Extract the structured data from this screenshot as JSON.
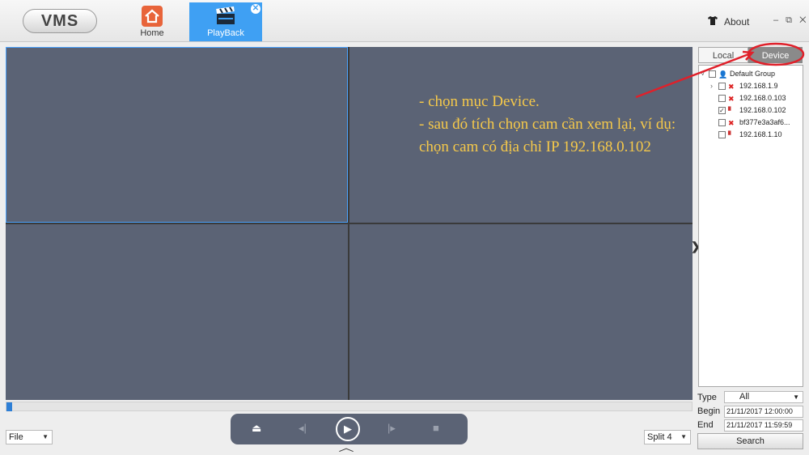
{
  "app": {
    "logo": "VMS"
  },
  "nav": {
    "home_label": "Home",
    "playback_label": "PlayBack",
    "about_label": "About",
    "window_controls": "– ⧉ ✕"
  },
  "annotation_text": "- chọn mục Device.\n- sau đó tích chọn cam cần xem lại, ví dụ: chọn cam có địa chỉ IP 192.168.0.102",
  "panel": {
    "tab_local": "Local",
    "tab_device": "Device",
    "tree": {
      "group": "Default Group",
      "devices": [
        {
          "label": "192.168.1.9",
          "checked": false,
          "status": "offline"
        },
        {
          "label": "192.168.0.103",
          "checked": false,
          "status": "offline"
        },
        {
          "label": "192.168.0.102",
          "checked": true,
          "status": "online"
        },
        {
          "label": "bf377e3a3af6...",
          "checked": false,
          "status": "offline"
        },
        {
          "label": "192.168.1.10",
          "checked": false,
          "status": "online"
        }
      ]
    }
  },
  "search": {
    "type_label": "Type",
    "type_value": "All",
    "begin_label": "Begin",
    "begin_value": "21/11/2017 12:00:00",
    "end_label": "End",
    "end_value": "21/11/2017 11:59:59",
    "button_label": "Search"
  },
  "controls": {
    "file_select": "File",
    "split_select": "Split 4"
  },
  "colors": {
    "accent": "#3fa0f3",
    "pane": "#5b6375",
    "annotation_text": "#f6c94a",
    "annotation_mark": "#e0202a"
  },
  "icons": {
    "home": "home-icon",
    "playback": "clapperboard-icon",
    "about": "shirt-icon",
    "play": "play-icon",
    "eject": "eject-icon"
  }
}
